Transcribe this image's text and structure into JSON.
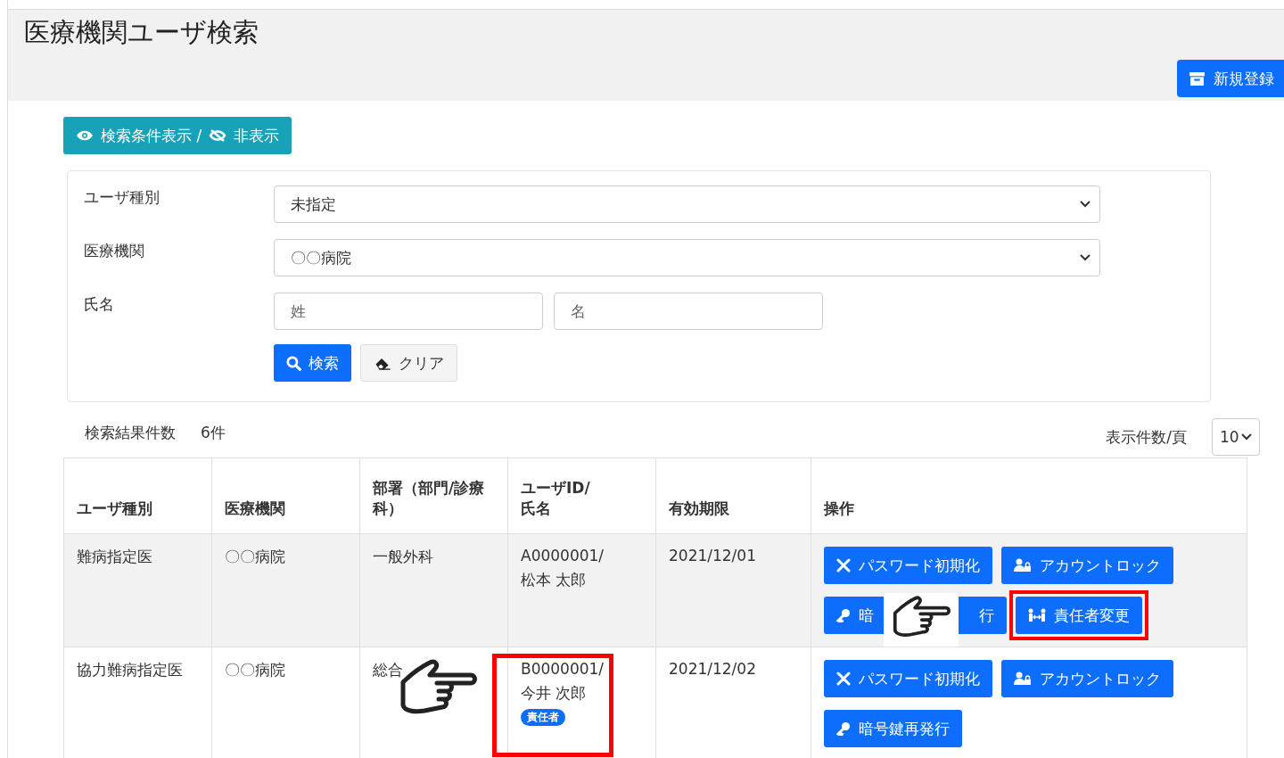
{
  "page_title": "医療機関ユーザ検索",
  "new_button": "新規登録",
  "toggle_button": {
    "show": "検索条件表示",
    "separator": "/",
    "hide": "非表示"
  },
  "filters": [
    {
      "kind": "select",
      "label": "ユーザ種別",
      "value": "未指定"
    },
    {
      "kind": "select",
      "label": "医療機関",
      "value": "〇〇病院"
    },
    {
      "kind": "name",
      "label": "氏名",
      "placeholders": [
        "姓",
        "名"
      ]
    }
  ],
  "search_button": "検索",
  "clear_button": "クリア",
  "result_count_label": "検索結果件数",
  "result_count": "6件",
  "per_page": {
    "label": "表示件数/頁",
    "value": "10"
  },
  "table": {
    "columns": [
      "ユーザ種別",
      "医療機関",
      "部署（部門/診療科）",
      "ユーザID/\n氏名",
      "有効期限",
      "操作"
    ],
    "rows": [
      {
        "user_type": "難病指定医",
        "institution": "〇〇病院",
        "department": "一般外科",
        "user_id": "A0000001/",
        "name": "松本  太郎",
        "badge": null,
        "expiry": "2021/12/01",
        "highlighted": true,
        "actions": [
          {
            "kind": "reset",
            "label": "パスワード初期化"
          },
          {
            "kind": "lock",
            "label": "アカウントロック"
          },
          {
            "kind": "key",
            "label": "暗",
            "label_end": "行"
          },
          {
            "kind": "owner",
            "label": "責任者変更"
          }
        ]
      },
      {
        "user_type": "協力難病指定医",
        "institution": "〇〇病院",
        "department": "総合",
        "user_id": "B0000001/",
        "name": "今井  次郎",
        "badge": "責任者",
        "expiry": "2021/12/02",
        "highlighted": false,
        "actions": [
          {
            "kind": "reset",
            "label": "パスワード初期化"
          },
          {
            "kind": "lock",
            "label": "アカウントロック"
          },
          {
            "kind": "key",
            "label": "暗号鍵再発行"
          }
        ]
      }
    ]
  }
}
